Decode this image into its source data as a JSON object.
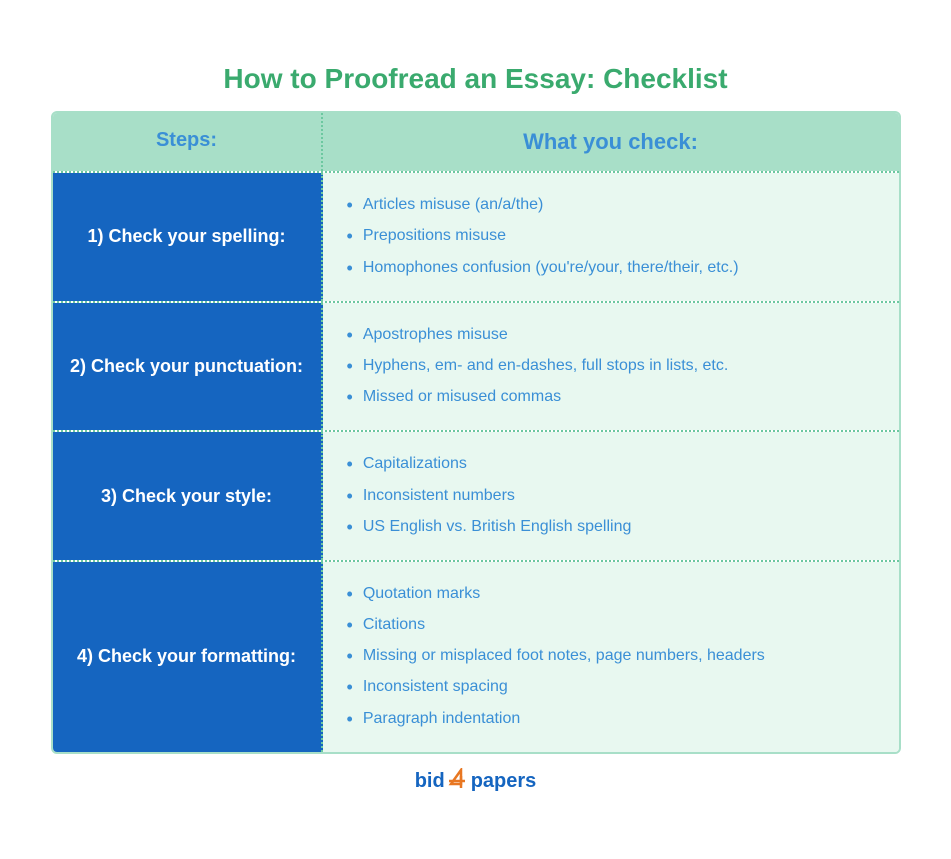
{
  "title": "How to Proofread an Essay: Checklist",
  "header": {
    "steps_label": "Steps:",
    "checks_label": "What you check:"
  },
  "rows": [
    {
      "step": "1) Check your spelling:",
      "items": [
        "Articles misuse (an/a/the)",
        "Prepositions misuse",
        "Homophones confusion (you're/your, there/their, etc.)"
      ]
    },
    {
      "step": "2) Check your punctuation:",
      "items": [
        "Apostrophes misuse",
        "Hyphens, em- and en-dashes, full stops in lists, etc.",
        "Missed or misused commas"
      ]
    },
    {
      "step": "3) Check your style:",
      "items": [
        "Capitalizations",
        "Inconsistent numbers",
        "US English vs. British English spelling"
      ]
    },
    {
      "step": "4) Check your formatting:",
      "items": [
        "Quotation marks",
        "Citations",
        "Missing or misplaced foot notes, page numbers, headers",
        "Inconsistent spacing",
        "Paragraph indentation"
      ]
    }
  ],
  "footer": {
    "bid": "bid",
    "four": "4",
    "papers": "papers"
  }
}
